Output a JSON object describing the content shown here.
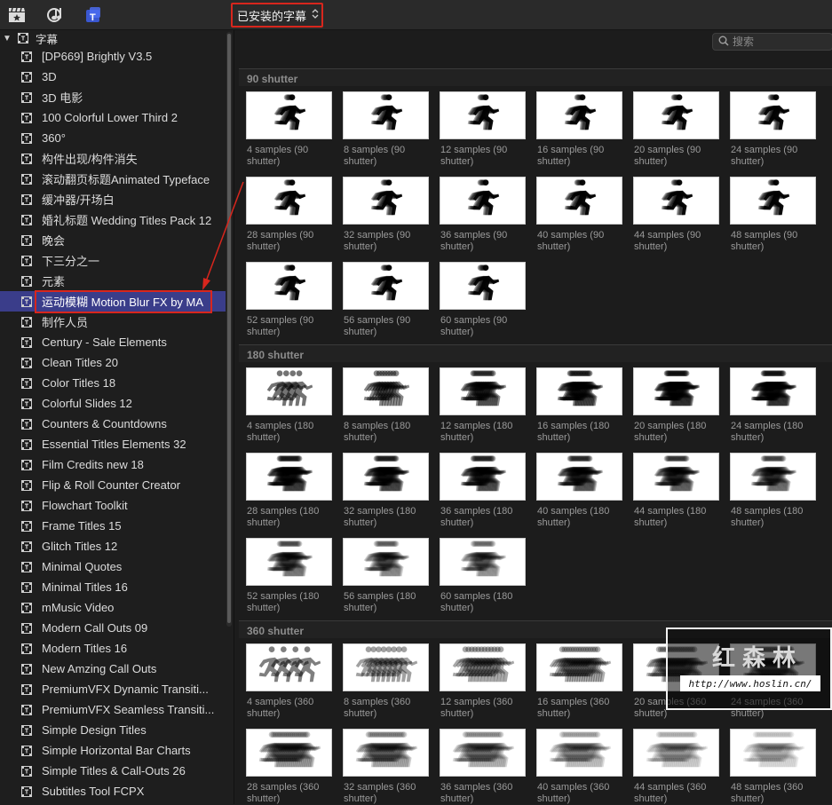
{
  "toolbar": {
    "icons": [
      "clapper-star-icon",
      "music-notes-icon",
      "titles-icon"
    ],
    "dropdown_label": "已安装的字幕",
    "dropdown_chevron": "⌃⌄"
  },
  "sidebar": {
    "root_label": "字幕",
    "items": [
      {
        "label": "[DP669] Brightly V3.5"
      },
      {
        "label": "3D"
      },
      {
        "label": "3D 电影"
      },
      {
        "label": "100 Colorful Lower Third 2"
      },
      {
        "label": "360°"
      },
      {
        "label": "构件出现/构件消失"
      },
      {
        "label": "滚动翻页标题Animated Typeface"
      },
      {
        "label": "缓冲器/开场白"
      },
      {
        "label": "婚礼标题 Wedding Titles Pack 12"
      },
      {
        "label": "晚会"
      },
      {
        "label": "下三分之一"
      },
      {
        "label": "元素"
      },
      {
        "label": "运动模糊 Motion Blur FX by MA",
        "selected": true
      },
      {
        "label": "制作人员"
      },
      {
        "label": "Century - Sale Elements"
      },
      {
        "label": "Clean Titles 20"
      },
      {
        "label": "Color Titles 18"
      },
      {
        "label": "Colorful Slides 12"
      },
      {
        "label": "Counters & Countdowns"
      },
      {
        "label": "Essential Titles Elements 32"
      },
      {
        "label": "Film Credits new 18"
      },
      {
        "label": "Flip & Roll Counter Creator"
      },
      {
        "label": "Flowchart Toolkit"
      },
      {
        "label": "Frame Titles 15"
      },
      {
        "label": "Glitch Titles 12"
      },
      {
        "label": "Minimal Quotes"
      },
      {
        "label": "Minimal Titles 16"
      },
      {
        "label": "mMusic Video"
      },
      {
        "label": "Modern Call Outs 09"
      },
      {
        "label": "Modern Titles 16"
      },
      {
        "label": "New Amzing Call Outs"
      },
      {
        "label": "PremiumVFX Dynamic Transiti..."
      },
      {
        "label": "PremiumVFX Seamless Transiti..."
      },
      {
        "label": "Simple Design Titles"
      },
      {
        "label": "Simple Horizontal Bar Charts"
      },
      {
        "label": "Simple Titles & Call-Outs 26"
      },
      {
        "label": "Subtitles Tool FCPX"
      }
    ]
  },
  "search": {
    "placeholder": "搜索"
  },
  "sections": [
    {
      "title": "90 shutter",
      "tiles": [
        {
          "l1": "4 samples (90",
          "l2": "shutter)"
        },
        {
          "l1": "8 samples (90",
          "l2": "shutter)"
        },
        {
          "l1": "12 samples (90",
          "l2": "shutter)"
        },
        {
          "l1": "16 samples (90",
          "l2": "shutter)"
        },
        {
          "l1": "20 samples (90",
          "l2": "shutter)"
        },
        {
          "l1": "24 samples (90",
          "l2": "shutter)"
        },
        {
          "l1": "28 samples (90",
          "l2": "shutter)"
        },
        {
          "l1": "32 samples (90",
          "l2": "shutter)"
        },
        {
          "l1": "36 samples (90",
          "l2": "shutter)"
        },
        {
          "l1": "40 samples (90",
          "l2": "shutter)"
        },
        {
          "l1": "44 samples (90",
          "l2": "shutter)"
        },
        {
          "l1": "48 samples (90",
          "l2": "shutter)"
        },
        {
          "l1": "52 samples (90",
          "l2": "shutter)"
        },
        {
          "l1": "56 samples (90",
          "l2": "shutter)"
        },
        {
          "l1": "60 samples (90",
          "l2": "shutter)"
        }
      ]
    },
    {
      "title": "180 shutter",
      "tiles": [
        {
          "l1": "4 samples (180",
          "l2": "shutter)"
        },
        {
          "l1": "8 samples (180",
          "l2": "shutter)"
        },
        {
          "l1": "12 samples (180",
          "l2": "shutter)"
        },
        {
          "l1": "16 samples (180",
          "l2": "shutter)"
        },
        {
          "l1": "20 samples (180",
          "l2": "shutter)"
        },
        {
          "l1": "24 samples (180",
          "l2": "shutter)"
        },
        {
          "l1": "28 samples (180",
          "l2": "shutter)"
        },
        {
          "l1": "32 samples (180",
          "l2": "shutter)"
        },
        {
          "l1": "36 samples (180",
          "l2": "shutter)"
        },
        {
          "l1": "40 samples (180",
          "l2": "shutter)"
        },
        {
          "l1": "44 samples (180",
          "l2": "shutter)"
        },
        {
          "l1": "48 samples (180",
          "l2": "shutter)"
        },
        {
          "l1": "52 samples (180",
          "l2": "shutter)"
        },
        {
          "l1": "56 samples (180",
          "l2": "shutter)"
        },
        {
          "l1": "60 samples (180",
          "l2": "shutter)"
        }
      ]
    },
    {
      "title": "360 shutter",
      "tiles": [
        {
          "l1": "4 samples (360",
          "l2": "shutter)"
        },
        {
          "l1": "8 samples (360",
          "l2": "shutter)"
        },
        {
          "l1": "12 samples (360",
          "l2": "shutter)"
        },
        {
          "l1": "16 samples (360",
          "l2": "shutter)"
        },
        {
          "l1": "20 samples (360",
          "l2": "shutter)"
        },
        {
          "l1": "24 samples (360",
          "l2": "shutter)"
        },
        {
          "l1": "28 samples (360",
          "l2": "shutter)"
        },
        {
          "l1": "32 samples (360",
          "l2": "shutter)"
        },
        {
          "l1": "36 samples (360",
          "l2": "shutter)"
        },
        {
          "l1": "40 samples (360",
          "l2": "shutter)"
        },
        {
          "l1": "44 samples (360",
          "l2": "shutter)"
        },
        {
          "l1": "48 samples (360",
          "l2": "shutter)"
        }
      ]
    }
  ],
  "watermark": {
    "title": "红森林",
    "url": "http://www.hoslin.cn/"
  },
  "colors": {
    "selection": "#3a3d8a",
    "highlight_border": "#d8261d"
  }
}
